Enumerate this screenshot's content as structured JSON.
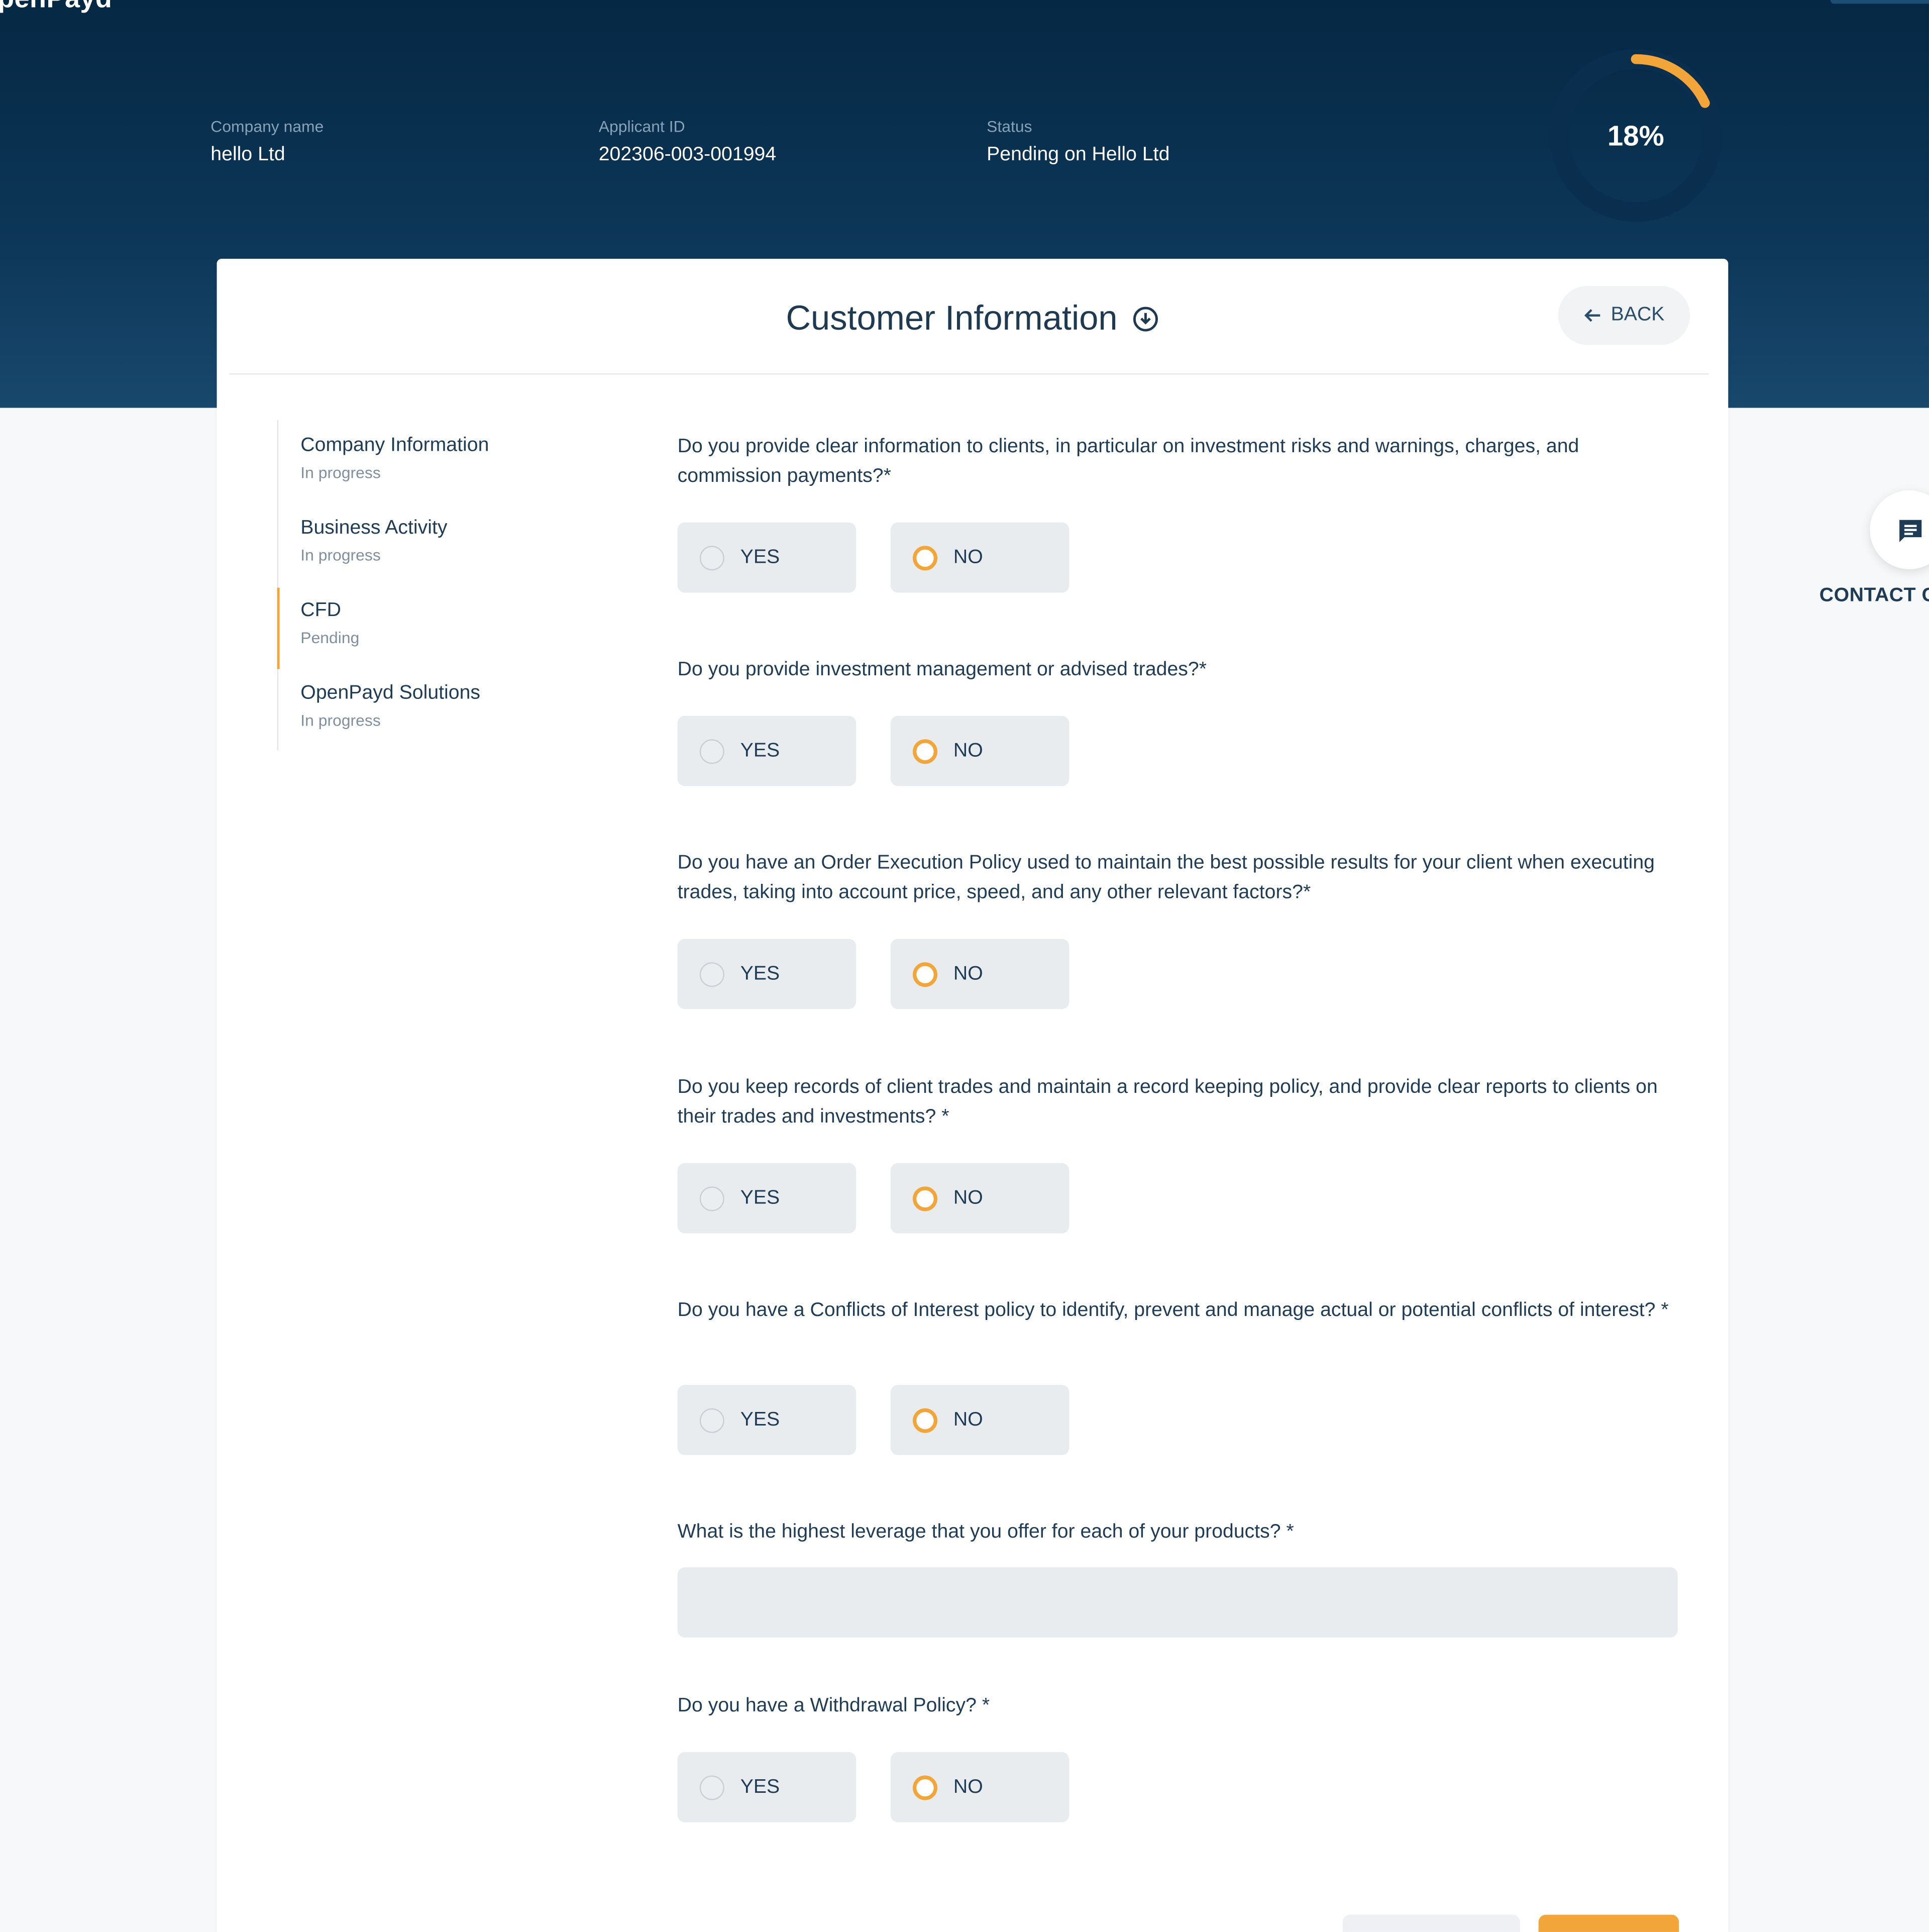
{
  "brand": {
    "logo_text": "penPayd"
  },
  "header": {
    "company_label": "Company name",
    "company_value": "hello Ltd",
    "applicant_label": "Applicant ID",
    "applicant_value": "202306-003-001994",
    "status_label": "Status",
    "status_value": "Pending on Hello Ltd",
    "progress_text": "18%",
    "progress_value": 0.18
  },
  "card": {
    "title": "Customer Information",
    "back_label": "BACK"
  },
  "steps": [
    {
      "title": "Company Information",
      "status": "In progress"
    },
    {
      "title": "Business Activity",
      "status": "In progress"
    },
    {
      "title": "CFD",
      "status": "Pending"
    },
    {
      "title": "OpenPayd Solutions",
      "status": "In progress"
    }
  ],
  "active_step": 2,
  "questions": [
    {
      "text": "Do you provide clear information to clients, in particular on investment risks and warnings, charges, and commission payments?*",
      "type": "yesno",
      "yes": "YES",
      "no": "NO",
      "selected": "no"
    },
    {
      "text": "Do you provide investment management or advised trades?*",
      "type": "yesno",
      "yes": "YES",
      "no": "NO",
      "selected": "no"
    },
    {
      "text": "Do you have an Order Execution Policy used to maintain the best possible results for your client when executing trades, taking into account price, speed, and any other relevant factors?*",
      "type": "yesno",
      "yes": "YES",
      "no": "NO",
      "selected": "no"
    },
    {
      "text": "Do you keep records of client trades and maintain a record keeping policy, and provide clear reports to clients on their trades and investments? *",
      "type": "yesno",
      "yes": "YES",
      "no": "NO",
      "selected": "no"
    },
    {
      "text": "Do you have a Conflicts of Interest policy to identify, prevent and manage actual or potential conflicts of interest? *",
      "type": "yesno",
      "yes": "YES",
      "no": "NO",
      "selected": "no"
    },
    {
      "text": "What is the highest leverage that you offer for each of your products? *",
      "type": "text",
      "value": ""
    },
    {
      "text": "Do you have a Withdrawal Policy? *",
      "type": "yesno",
      "yes": "YES",
      "no": "NO",
      "selected": "no"
    }
  ],
  "contact": {
    "label": "CONTACT C"
  },
  "colors": {
    "accent": "#f2a63a",
    "header_dark": "#052844",
    "text_primary": "#1f3c57",
    "option_bg": "#e9ecef"
  },
  "icons": {
    "info": "info-circle-icon",
    "back": "arrow-left-icon",
    "contact": "chat-icon"
  }
}
